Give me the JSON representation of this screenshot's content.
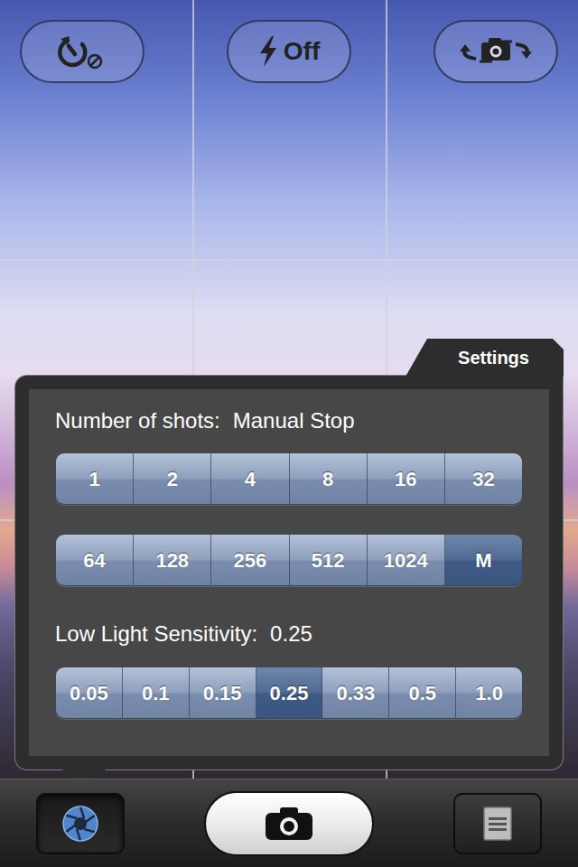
{
  "viewfinder": {
    "grid_visible": true
  },
  "top_bar": {
    "timer_enabled": false,
    "flash": "Off"
  },
  "settings": {
    "open": true,
    "tab": "Settings",
    "shots": {
      "label": "Number of shots:",
      "value": "Manual Stop",
      "option_rows": [
        [
          {
            "label": "1",
            "selected": false
          },
          {
            "label": "2",
            "selected": false
          },
          {
            "label": "4",
            "selected": false
          },
          {
            "label": "8",
            "selected": false
          },
          {
            "label": "16",
            "selected": false
          },
          {
            "label": "32",
            "selected": false
          }
        ],
        [
          {
            "label": "64",
            "selected": false
          },
          {
            "label": "128",
            "selected": false
          },
          {
            "label": "256",
            "selected": false
          },
          {
            "label": "512",
            "selected": false
          },
          {
            "label": "1024",
            "selected": false
          },
          {
            "label": "M",
            "selected": true
          }
        ]
      ]
    },
    "sensitivity": {
      "label": "Low Light Sensitivity:",
      "value": "0.25",
      "options": [
        {
          "label": "0.05",
          "selected": false
        },
        {
          "label": "0.1",
          "selected": false
        },
        {
          "label": "0.15",
          "selected": false
        },
        {
          "label": "0.25",
          "selected": true
        },
        {
          "label": "0.33",
          "selected": false
        },
        {
          "label": "0.5",
          "selected": false
        },
        {
          "label": "1.0",
          "selected": false
        }
      ]
    }
  },
  "toolbar": {
    "buttons": [
      {
        "kind": "settings",
        "selected": true
      },
      {
        "kind": "shutter",
        "selected": false
      },
      {
        "kind": "menu",
        "selected": false
      }
    ]
  }
}
